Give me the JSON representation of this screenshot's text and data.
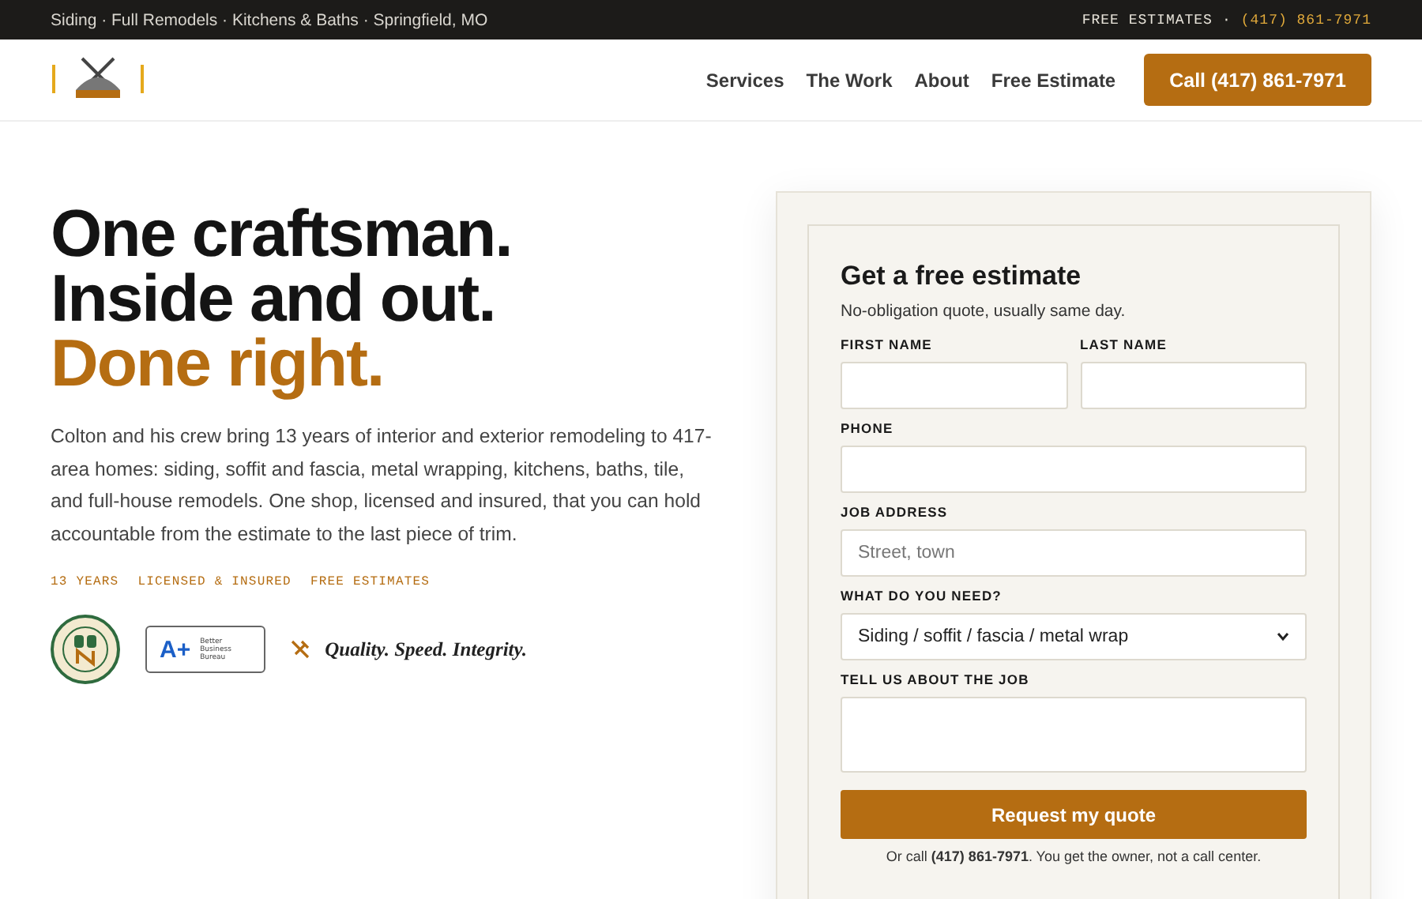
{
  "topbar": {
    "services": "Siding · Full Remodels · Kitchens & Baths · Springfield, MO",
    "label": "FREE ESTIMATES",
    "separator": "·",
    "phone": "(417) 861-7971"
  },
  "nav": {
    "links": [
      {
        "label": "Services"
      },
      {
        "label": "The Work"
      },
      {
        "label": "About"
      },
      {
        "label": "Free Estimate"
      }
    ],
    "cta": "Call (417) 861-7971"
  },
  "hero": {
    "headline": [
      "One craftsman.",
      "Inside and out."
    ],
    "headline_accent": "Done right.",
    "intro": "Colton and his crew bring 13 years of interior and exterior remodeling to 417-area homes: siding, soffit and fascia, metal wrapping, kitchens, baths, tile, and full-house remodels. One shop, licensed and insured, that you can hold accountable from the estimate to the last piece of trim.",
    "tags": [
      "13 YEARS",
      "LICENSED & INSURED",
      "FREE ESTIMATES"
    ],
    "bbb": {
      "grade": "A+",
      "name": "Better Business Bureau"
    },
    "motto": "Quality. Speed. Integrity."
  },
  "form": {
    "title": "Get a free estimate",
    "subtitle": "No-obligation quote, usually same day.",
    "fields": [
      {
        "kind": "pair",
        "items": [
          {
            "label": "FIRST NAME"
          },
          {
            "label": "LAST NAME"
          }
        ]
      },
      {
        "kind": "input",
        "label": "PHONE"
      },
      {
        "kind": "input",
        "label": "JOB ADDRESS",
        "placeholder": "Street, town"
      },
      {
        "kind": "select",
        "label": "WHAT DO YOU NEED?",
        "value": "Siding / soffit / fascia / metal wrap"
      },
      {
        "kind": "textarea",
        "label": "TELL US ABOUT THE JOB"
      }
    ],
    "submit": "Request my quote",
    "footnote": "Or call **(417) 861-7971**. You get the owner, not a call center."
  }
}
